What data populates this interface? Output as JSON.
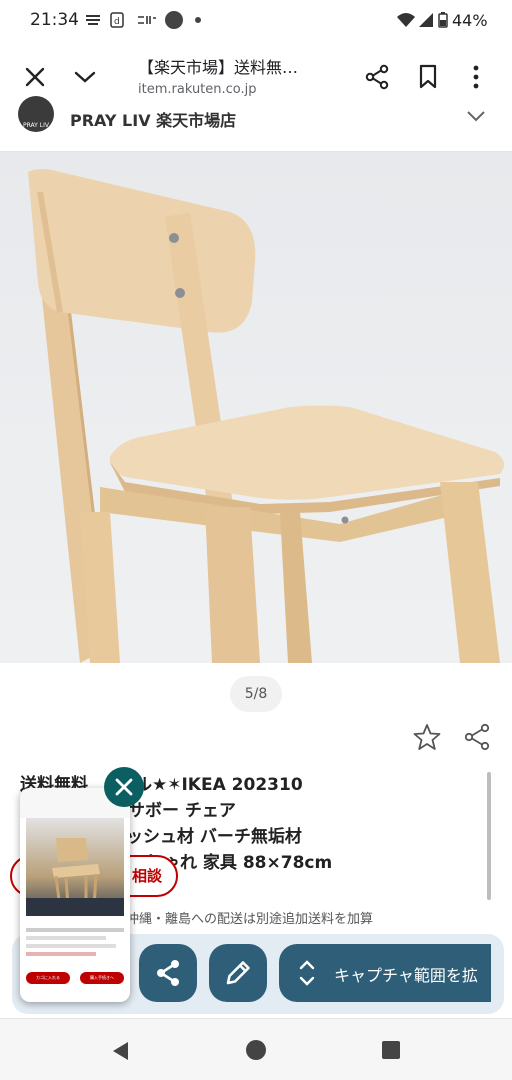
{
  "status_bar": {
    "time": "21:34",
    "battery": "44%",
    "icons": [
      "mail-icon",
      "d-icon",
      "app-icon",
      "circle-icon",
      "dot-icon",
      "wifi-icon",
      "signal-icon",
      "battery-icon"
    ]
  },
  "browser": {
    "title": "【楽天市場】送料無…",
    "url": "item.rakuten.co.jp",
    "icons": [
      "close-icon",
      "chevron-down-icon",
      "share-icon",
      "bookmark-icon",
      "more-icon"
    ]
  },
  "shop": {
    "name": "PRAY LIV 楽天市場店",
    "avatar_text": "PRAY LIV"
  },
  "gallery": {
    "pager": "5/8"
  },
  "product": {
    "title_lines": [
      "送料無料★★セール★✶IKEA 202310",
      "リサボー チェア",
      "アッシュ材 バーチ無垢材",
      "おしゃれ 家具 88×78cm"
    ],
    "title_visible_lines": [
      "ール★✶IKEA 202310",
      "サボー チェア",
      "ッシュ材 バーチ無垢材",
      "しゃれ 家具 88×78cm"
    ],
    "title_first_prefix": "送料無料",
    "consult_label": "相談",
    "shipping_note": "沖縄・離島への配送は別途追加送料を加算"
  },
  "capture_toolbar": {
    "expand_label": "キャプチャ範囲を拡",
    "icons": [
      "share-icon",
      "edit-icon",
      "expand-vertical-icon",
      "close-icon"
    ]
  },
  "thumbnail": {
    "buttons": [
      "カゴに入れる",
      "購入手続きへ"
    ]
  },
  "colors": {
    "rakuten_red": "#bf0000",
    "capture_button": "#2f5f78",
    "close_button": "#0b5f63"
  }
}
